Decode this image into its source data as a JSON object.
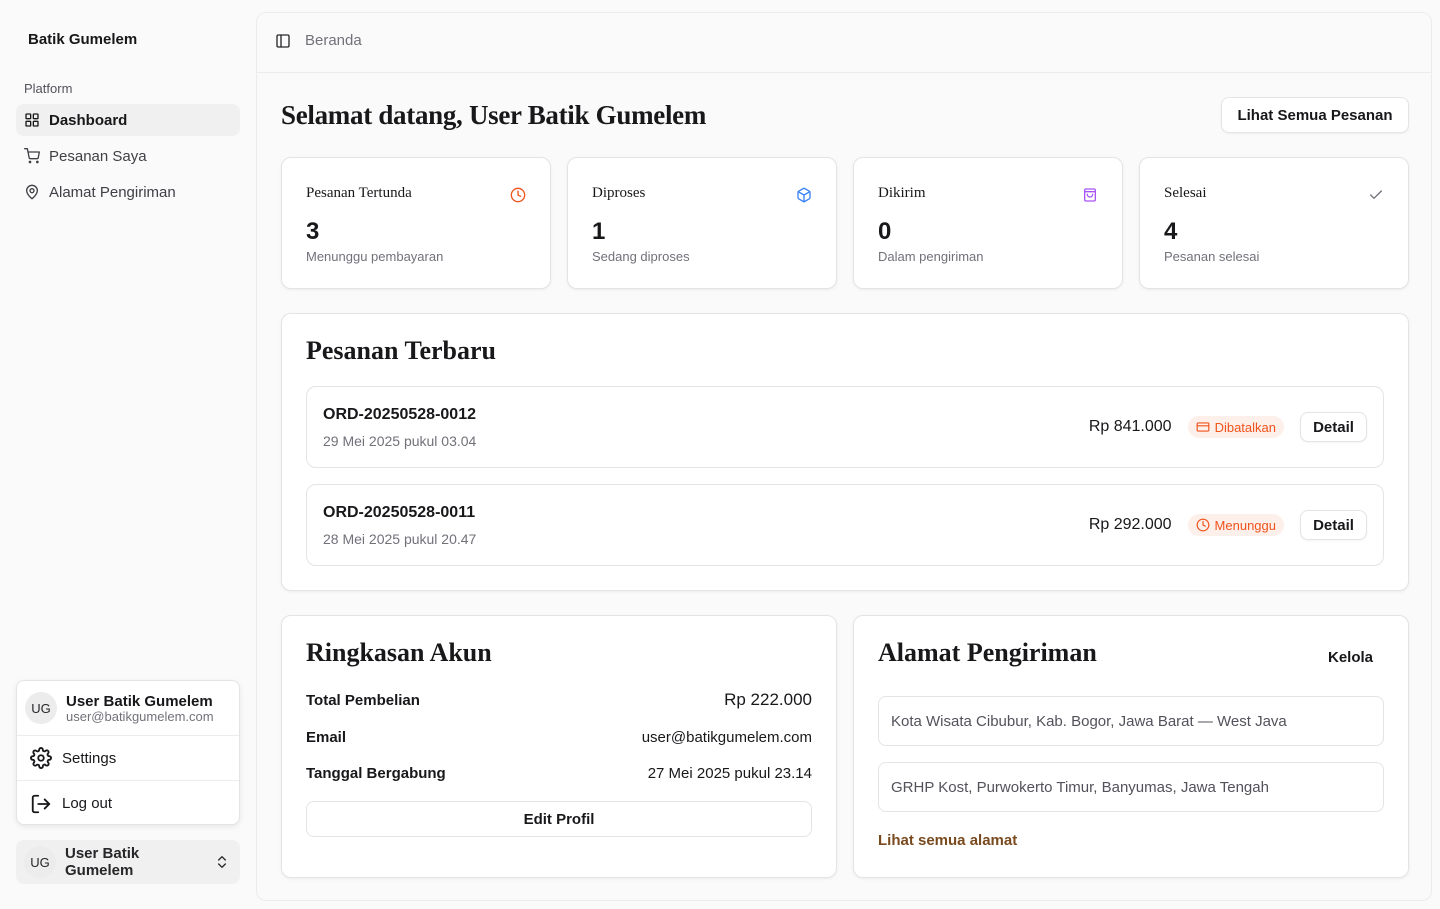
{
  "sidebar": {
    "brand": "Batik Gumelem",
    "group_label": "Platform",
    "items": [
      {
        "label": "Dashboard",
        "icon": "grid-icon",
        "active": true
      },
      {
        "label": "Pesanan Saya",
        "icon": "cart-icon",
        "active": false
      },
      {
        "label": "Alamat Pengiriman",
        "icon": "map-pin-icon",
        "active": false
      }
    ],
    "user_menu": {
      "initials": "UG",
      "name": "User Batik Gumelem",
      "email": "user@batikgumelem.com",
      "settings_label": "Settings",
      "logout_label": "Log out"
    },
    "footer_user": {
      "initials": "UG",
      "name": "User Batik Gumelem"
    }
  },
  "topbar": {
    "breadcrumb": "Beranda"
  },
  "main": {
    "welcome": "Selamat datang, User Batik Gumelem",
    "view_all_orders": "Lihat Semua Pesanan",
    "stats": [
      {
        "title": "Pesanan Tertunda",
        "value": "3",
        "subtitle": "Menunggu pembayaran",
        "icon": "clock-icon",
        "color": "#f0531c"
      },
      {
        "title": "Diproses",
        "value": "1",
        "subtitle": "Sedang diproses",
        "icon": "package-icon",
        "color": "#3b82f6"
      },
      {
        "title": "Dikirim",
        "value": "0",
        "subtitle": "Dalam pengiriman",
        "icon": "shopping-bag-icon",
        "color": "#a855f7"
      },
      {
        "title": "Selesai",
        "value": "4",
        "subtitle": "Pesanan selesai",
        "icon": "check-icon",
        "color": "#71717a"
      }
    ],
    "recent_orders": {
      "title": "Pesanan Terbaru",
      "orders": [
        {
          "id": "ORD-20250528-0012",
          "date": "29 Mei 2025 pukul 03.04",
          "price": "Rp 841.000",
          "status": "Dibatalkan",
          "status_icon": "credit-card-icon",
          "detail": "Detail"
        },
        {
          "id": "ORD-20250528-0011",
          "date": "28 Mei 2025 pukul 20.47",
          "price": "Rp 292.000",
          "status": "Menunggu",
          "status_icon": "clock-icon",
          "detail": "Detail"
        }
      ]
    },
    "account_summary": {
      "title": "Ringkasan Akun",
      "rows": [
        {
          "label": "Total Pembelian",
          "value": "Rp 222.000"
        },
        {
          "label": "Email",
          "value": "user@batikgumelem.com"
        },
        {
          "label": "Tanggal Bergabung",
          "value": "27 Mei 2025 pukul 23.14"
        }
      ],
      "edit_button": "Edit Profil"
    },
    "shipping_address": {
      "title": "Alamat Pengiriman",
      "manage": "Kelola",
      "addresses": [
        "Kota Wisata Cibubur, Kab. Bogor, Jawa Barat — West Java",
        "GRHP Kost, Purwokerto Timur, Banyumas, Jawa Tengah"
      ],
      "see_all": "Lihat semua alamat"
    }
  },
  "colors": {
    "accent_orange": "#f0531c",
    "link_brown": "#7a4a1f",
    "border": "#e4e4e7"
  }
}
